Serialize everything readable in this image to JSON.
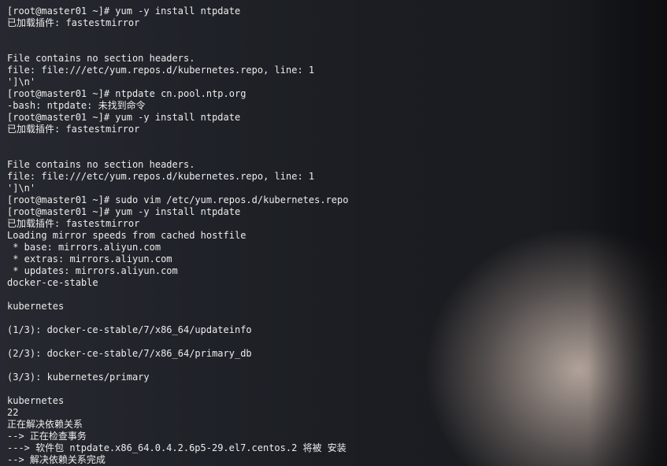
{
  "terminal": {
    "lines": [
      "[root@master01 ~]# yum -y install ntpdate",
      "已加载插件: fastestmirror",
      "",
      "",
      "File contains no section headers.",
      "file: file:///etc/yum.repos.d/kubernetes.repo, line: 1",
      "']\\n'",
      "[root@master01 ~]# ntpdate cn.pool.ntp.org",
      "-bash: ntpdate: 未找到命令",
      "[root@master01 ~]# yum -y install ntpdate",
      "已加载插件: fastestmirror",
      "",
      "",
      "File contains no section headers.",
      "file: file:///etc/yum.repos.d/kubernetes.repo, line: 1",
      "']\\n'",
      "[root@master01 ~]# sudo vim /etc/yum.repos.d/kubernetes.repo",
      "[root@master01 ~]# yum -y install ntpdate",
      "已加载插件: fastestmirror",
      "Loading mirror speeds from cached hostfile",
      " * base: mirrors.aliyun.com",
      " * extras: mirrors.aliyun.com",
      " * updates: mirrors.aliyun.com",
      "docker-ce-stable",
      "",
      "kubernetes",
      "",
      "(1/3): docker-ce-stable/7/x86_64/updateinfo",
      "",
      "(2/3): docker-ce-stable/7/x86_64/primary_db",
      "",
      "(3/3): kubernetes/primary",
      "",
      "kubernetes",
      "22",
      "正在解决依赖关系",
      "--> 正在检查事务",
      "---> 软件包 ntpdate.x86_64.0.4.2.6p5-29.el7.centos.2 将被 安装",
      "--> 解决依赖关系完成"
    ]
  }
}
